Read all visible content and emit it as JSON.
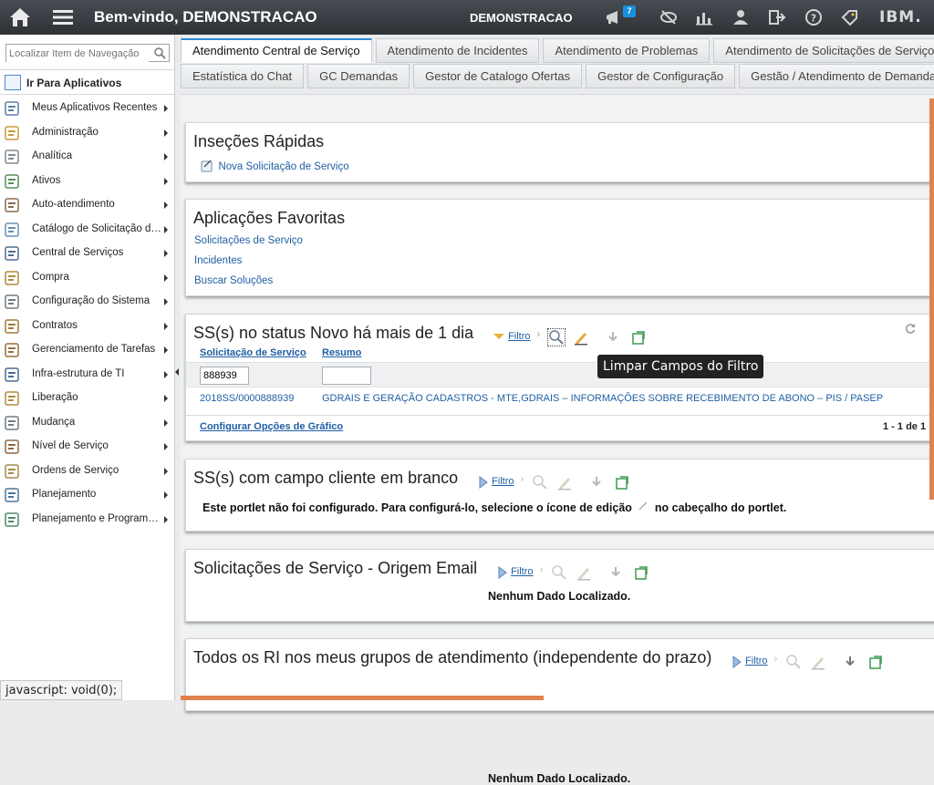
{
  "topbar": {
    "welcome": "Bem-vindo, DEMONSTRACAO",
    "user": "DEMONSTRACAO",
    "notification_count": "7",
    "brand": "IBM."
  },
  "sidebar": {
    "search_placeholder": "Localizar Item de Navegação",
    "goto_label": "Ir Para Aplicativos",
    "items": [
      {
        "label": "Meus Aplicativos Recentes",
        "icon": "recent-apps-icon"
      },
      {
        "label": "Administração",
        "icon": "administration-icon"
      },
      {
        "label": "Analítica",
        "icon": "analytics-icon"
      },
      {
        "label": "Ativos",
        "icon": "assets-icon"
      },
      {
        "label": "Auto-atendimento",
        "icon": "self-service-icon"
      },
      {
        "label": "Catálogo de Solicitação de Serviço",
        "icon": "catalog-icon"
      },
      {
        "label": "Central de Serviços",
        "icon": "service-desk-icon"
      },
      {
        "label": "Compra",
        "icon": "purchasing-icon"
      },
      {
        "label": "Configuração do Sistema",
        "icon": "system-config-icon"
      },
      {
        "label": "Contratos",
        "icon": "contracts-icon"
      },
      {
        "label": "Gerenciamento de Tarefas",
        "icon": "task-management-icon"
      },
      {
        "label": "Infra-estrutura de TI",
        "icon": "it-infrastructure-icon"
      },
      {
        "label": "Liberação",
        "icon": "release-icon"
      },
      {
        "label": "Mudança",
        "icon": "change-icon"
      },
      {
        "label": "Nível de Serviço",
        "icon": "service-level-icon"
      },
      {
        "label": "Ordens de Serviço",
        "icon": "work-orders-icon"
      },
      {
        "label": "Planejamento",
        "icon": "planning-icon"
      },
      {
        "label": "Planejamento e Programação",
        "icon": "scheduling-icon"
      }
    ]
  },
  "status_bar": "javascript: void(0);",
  "tabs": {
    "row1": [
      "Atendimento Central de Serviço",
      "Atendimento de Incidentes",
      "Atendimento de Problemas",
      "Atendimento de Solicitações de Serviço"
    ],
    "row2": [
      "Estatística do Chat",
      "GC Demandas",
      "Gestor de Catalogo Ofertas",
      "Gestor de Configuração",
      "Gestão / Atendimento de Demandas"
    ]
  },
  "quick_inserts": {
    "title": "Inseções Rápidas",
    "link": "Nova Solicitação de Serviço"
  },
  "favorites": {
    "title": "Aplicações Favoritas",
    "links": [
      "Solicitações de Serviço",
      "Incidentes",
      "Buscar Soluções"
    ]
  },
  "portlet_new_sr": {
    "title": "SS(s) no status Novo há mais de 1 dia",
    "filter_label": "Filtro",
    "columns": [
      "Solicitação de Serviço",
      "Resumo"
    ],
    "filter_value": "888939",
    "rows": [
      {
        "id": "2018SS/0000888939",
        "summary": "GDRAIS E GERAÇÃO CADASTROS - MTE,GDRAIS – INFORMAÇÕES SOBRE RECEBIMENTO DE ABONO – PIS / PASEP"
      }
    ],
    "configure_chart": "Configurar Opções de Gráfico",
    "pagination": "1 - 1 de 1"
  },
  "tooltip": "Limpar Campos do Filtro",
  "portlet_blank_client": {
    "title": "SS(s) com campo cliente em branco",
    "filter_label": "Filtro",
    "message_part1": "Este portlet não foi configurado. Para configurá-lo, selecione o ícone de edição",
    "message_part2": "no cabeçalho do portlet."
  },
  "portlet_email": {
    "title": "Solicitações de Serviço - Origem Email",
    "filter_label": "Filtro",
    "message": "Nenhum Dado Localizado."
  },
  "portlet_ri": {
    "title": "Todos os RI nos meus grupos de atendimento (independente do prazo)",
    "filter_label": "Filtro",
    "message": "Nenhum Dado Localizado."
  }
}
